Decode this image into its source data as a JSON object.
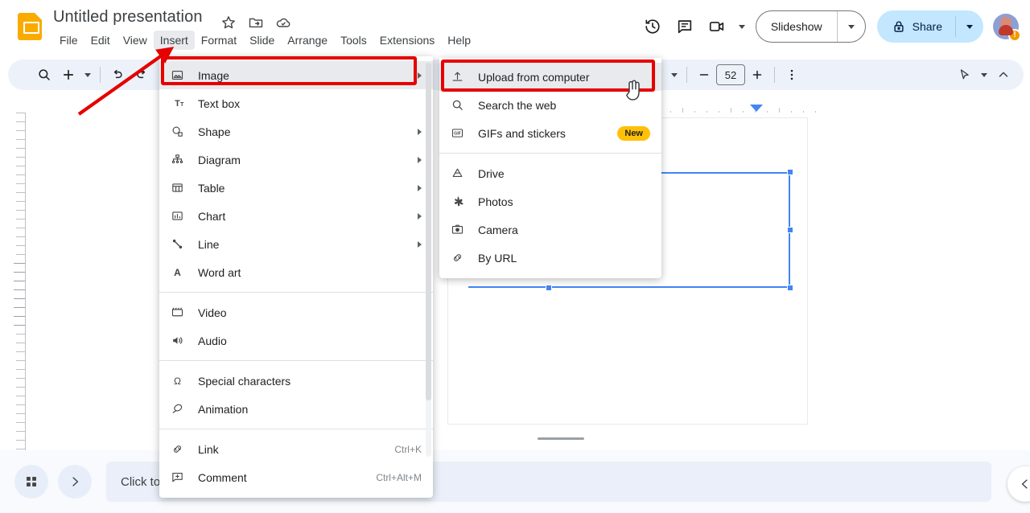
{
  "app": {
    "doc_title": "Untitled presentation",
    "logo_name": "google-slides-logo"
  },
  "title_icons": [
    {
      "name": "star-icon",
      "label": "Star"
    },
    {
      "name": "move-to-folder-icon",
      "label": "Move"
    },
    {
      "name": "cloud-saved-icon",
      "label": "Saved to Drive"
    }
  ],
  "menubar": {
    "items": [
      {
        "label": "File",
        "active": false
      },
      {
        "label": "Edit",
        "active": false
      },
      {
        "label": "View",
        "active": false
      },
      {
        "label": "Insert",
        "active": true
      },
      {
        "label": "Format",
        "active": false
      },
      {
        "label": "Slide",
        "active": false
      },
      {
        "label": "Arrange",
        "active": false
      },
      {
        "label": "Tools",
        "active": false
      },
      {
        "label": "Extensions",
        "active": false
      },
      {
        "label": "Help",
        "active": false
      }
    ]
  },
  "topright": {
    "history_icon": "version-history-icon",
    "comment_icon": "comment-history-icon",
    "meet_icon": "video-camera-icon",
    "slideshow_label": "Slideshow",
    "share_label": "Share",
    "share_lock_icon": "lock-icon",
    "share_bg": "#c2e7ff",
    "avatar_badge": "!"
  },
  "toolbar": {
    "search_icon": "search-icon",
    "new_slide_icon": "plus-icon",
    "undo_icon": "undo-icon",
    "redo_icon": "redo-icon",
    "font_size": "52",
    "minus_label": "−",
    "plus_label": "+",
    "more_icon": "more-vertical-icon",
    "cursor_tool_icon": "select-cursor-icon",
    "collapse_icon": "chevron-up-icon",
    "bg_color": "#edf2fa"
  },
  "insert_menu": {
    "items": [
      {
        "label": "Image",
        "icon": "image-icon",
        "arrow": true,
        "shortcut": "",
        "badge": "",
        "highlight": true
      },
      {
        "label": "Text box",
        "icon": "text-box-icon",
        "arrow": false,
        "shortcut": "",
        "badge": "",
        "highlight": false
      },
      {
        "label": "Shape",
        "icon": "shape-icon",
        "arrow": true,
        "shortcut": "",
        "badge": "",
        "highlight": false
      },
      {
        "label": "Diagram",
        "icon": "diagram-icon",
        "arrow": true,
        "shortcut": "",
        "badge": "",
        "highlight": false
      },
      {
        "label": "Table",
        "icon": "table-icon",
        "arrow": true,
        "shortcut": "",
        "badge": "",
        "highlight": false
      },
      {
        "label": "Chart",
        "icon": "chart-icon",
        "arrow": true,
        "shortcut": "",
        "badge": "",
        "highlight": false
      },
      {
        "label": "Line",
        "icon": "line-icon",
        "arrow": true,
        "shortcut": "",
        "badge": "",
        "highlight": false
      },
      {
        "label": "Word art",
        "icon": "word-art-icon",
        "arrow": false,
        "shortcut": "",
        "badge": "",
        "highlight": false
      },
      {
        "sep": true
      },
      {
        "label": "Video",
        "icon": "video-icon",
        "arrow": false,
        "shortcut": "",
        "badge": "",
        "highlight": false
      },
      {
        "label": "Audio",
        "icon": "audio-icon",
        "arrow": false,
        "shortcut": "",
        "badge": "",
        "highlight": false
      },
      {
        "sep": true
      },
      {
        "label": "Special characters",
        "icon": "omega-icon",
        "arrow": false,
        "shortcut": "",
        "badge": "",
        "highlight": false
      },
      {
        "label": "Animation",
        "icon": "animation-icon",
        "arrow": false,
        "shortcut": "",
        "badge": "",
        "highlight": false
      },
      {
        "sep": true
      },
      {
        "label": "Link",
        "icon": "link-icon",
        "arrow": false,
        "shortcut": "Ctrl+K",
        "badge": "",
        "highlight": false
      },
      {
        "label": "Comment",
        "icon": "comment-plus-icon",
        "arrow": false,
        "shortcut": "Ctrl+Alt+M",
        "badge": "",
        "highlight": false
      }
    ]
  },
  "image_submenu": {
    "items": [
      {
        "label": "Upload from computer",
        "icon": "upload-icon",
        "badge": "",
        "highlight": true
      },
      {
        "label": "Search the web",
        "icon": "search-icon",
        "badge": "",
        "highlight": false
      },
      {
        "label": "GIFs and stickers",
        "icon": "gif-icon",
        "badge": "New",
        "highlight": false
      },
      {
        "sep": true
      },
      {
        "label": "Drive",
        "icon": "drive-icon",
        "badge": "",
        "highlight": false
      },
      {
        "label": "Photos",
        "icon": "photos-icon",
        "badge": "",
        "highlight": false
      },
      {
        "label": "Camera",
        "icon": "camera-icon",
        "badge": "",
        "highlight": false
      },
      {
        "label": "By URL",
        "icon": "link-icon",
        "badge": "",
        "highlight": false
      }
    ]
  },
  "annotations": {
    "highlight_color": "#e60000",
    "arrow_name": "red-pointer-arrow",
    "box_image_name": "red-highlight-image-item",
    "box_upload_name": "red-highlight-upload-item",
    "cursor_name": "hand-cursor"
  },
  "canvas": {
    "selection_color": "#4285f4",
    "selected_object": "text-box"
  },
  "bottombar": {
    "grid_icon": "grid-view-icon",
    "next_icon": "chevron-right-icon",
    "notes_placeholder": "Click to add speaker notes",
    "panel_toggle_icon": "chevron-left-icon"
  }
}
